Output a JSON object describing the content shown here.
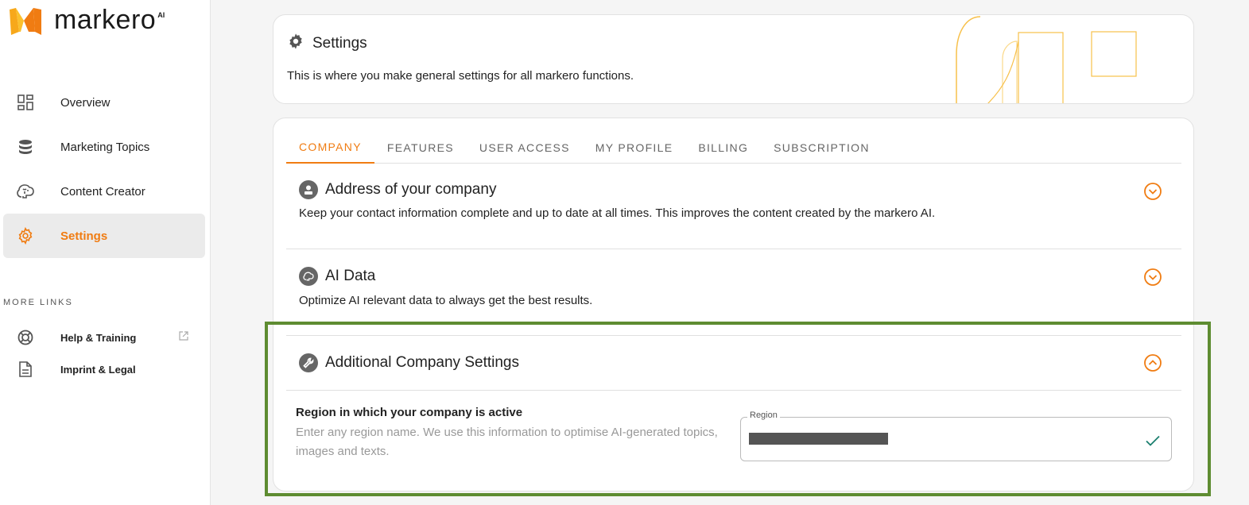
{
  "brand": {
    "name": "markero",
    "suffix": "AI"
  },
  "sidebar": {
    "items": [
      {
        "label": "Overview",
        "icon": "dashboard-icon"
      },
      {
        "label": "Marketing Topics",
        "icon": "database-icon"
      },
      {
        "label": "Content Creator",
        "icon": "brain-icon"
      },
      {
        "label": "Settings",
        "icon": "gear-icon"
      }
    ],
    "more_links_title": "MORE LINKS",
    "links": [
      {
        "label": "Help & Training",
        "icon": "lifebuoy-icon"
      },
      {
        "label": "Imprint & Legal",
        "icon": "document-icon"
      }
    ]
  },
  "header": {
    "title": "Settings",
    "description": "This is where you make general settings for all markero functions."
  },
  "tabs": [
    "COMPANY",
    "FEATURES",
    "USER ACCESS",
    "MY PROFILE",
    "BILLING",
    "SUBSCRIPTION"
  ],
  "sections": {
    "address": {
      "title": "Address of your company",
      "description": "Keep your contact information complete and up to date at all times. This improves the content created by the markero AI."
    },
    "ai_data": {
      "title": "AI Data",
      "description": "Optimize AI relevant data to always get the best results."
    },
    "additional": {
      "title": "Additional Company Settings"
    }
  },
  "region": {
    "title": "Region in which your company is active",
    "description": "Enter any region name. We use this information to optimise AI-generated topics, images and texts.",
    "field_label": "Region"
  },
  "colors": {
    "accent": "#f07c12",
    "highlight": "#5e8c31",
    "check": "#1a7f6e"
  }
}
